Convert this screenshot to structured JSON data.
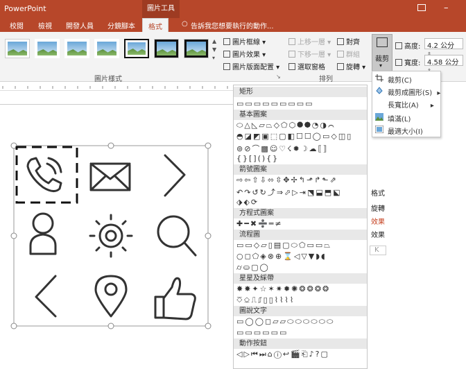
{
  "title_bar": {
    "app": "PowerPoint",
    "context": "圖片工具"
  },
  "tabs": [
    "校閱",
    "檢視",
    "開發人員",
    "分鏡腳本",
    "格式"
  ],
  "tell_me": "告訴我您想要執行的動作...",
  "styles_group": {
    "label": "圖片樣式"
  },
  "picture_options": [
    "圖片框線",
    "圖片效果",
    "圖片版面配置"
  ],
  "arrange_group": {
    "label": "排列",
    "items": [
      "上移一層",
      "下移一層",
      "選取窗格",
      "對齊",
      "群組",
      "旋轉"
    ]
  },
  "crop_button": "裁剪",
  "size": {
    "height_label": "高度:",
    "height_value": "4.2 公分",
    "width_label": "寬度:",
    "width_value": "4.58 公分"
  },
  "crop_menu": [
    "裁剪(C)",
    "裁剪成圖形(S)",
    "長寬比(A)",
    "填滿(L)",
    "最適大小(I)"
  ],
  "shape_categories": [
    "矩形",
    "基本圖案",
    "箭號圖案",
    "方程式圖案",
    "流程圖",
    "星星及綵帶",
    "圖說文字",
    "動作按鈕"
  ],
  "side_texts": [
    "格式",
    "旋轉",
    "效果",
    "效果",
    "K"
  ],
  "icons": [
    "phone",
    "envelope",
    "chevron-right",
    "user",
    "gear",
    "search",
    "chevron-left",
    "map-pin",
    "thumbs-up"
  ]
}
